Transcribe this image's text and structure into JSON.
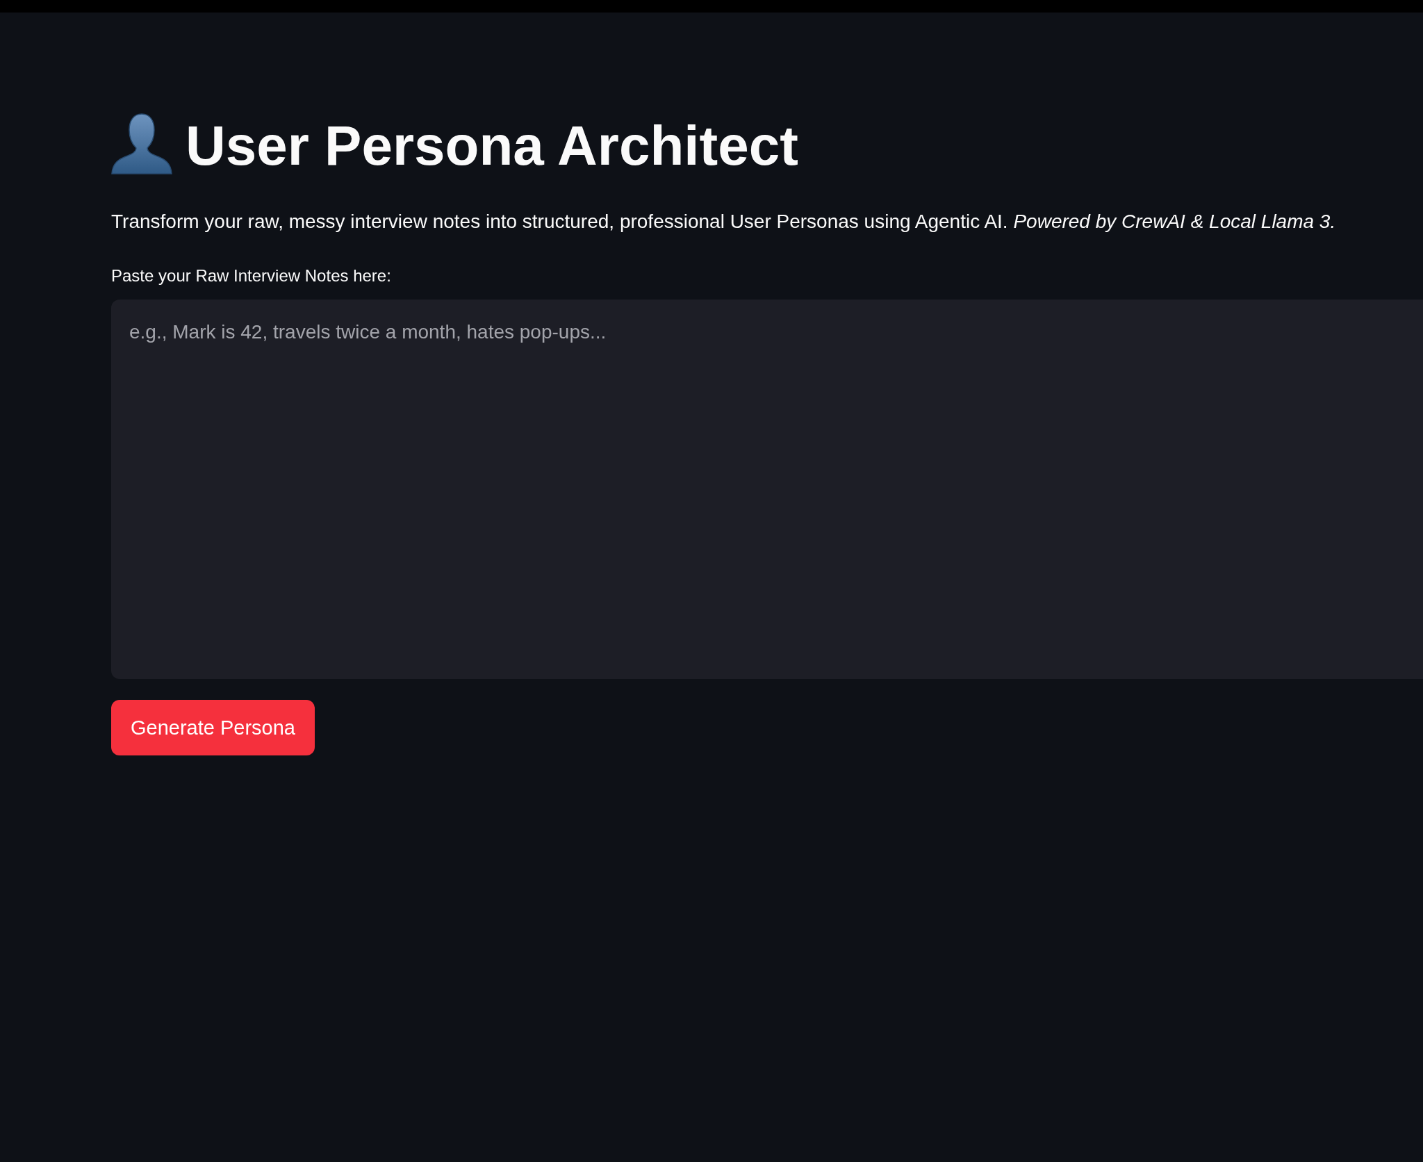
{
  "title": "User Persona Architect",
  "description": "Transform your raw, messy interview notes into structured, professional User Personas using Agentic AI. *Powered by CrewAI & Local Llama 3.*",
  "notes_field": {
    "label": "Paste your Raw Interview Notes here:",
    "placeholder": "e.g., Mark is 42, travels twice a month, hates pop-ups..."
  },
  "generate_button": {
    "label": "Generate Persona"
  }
}
